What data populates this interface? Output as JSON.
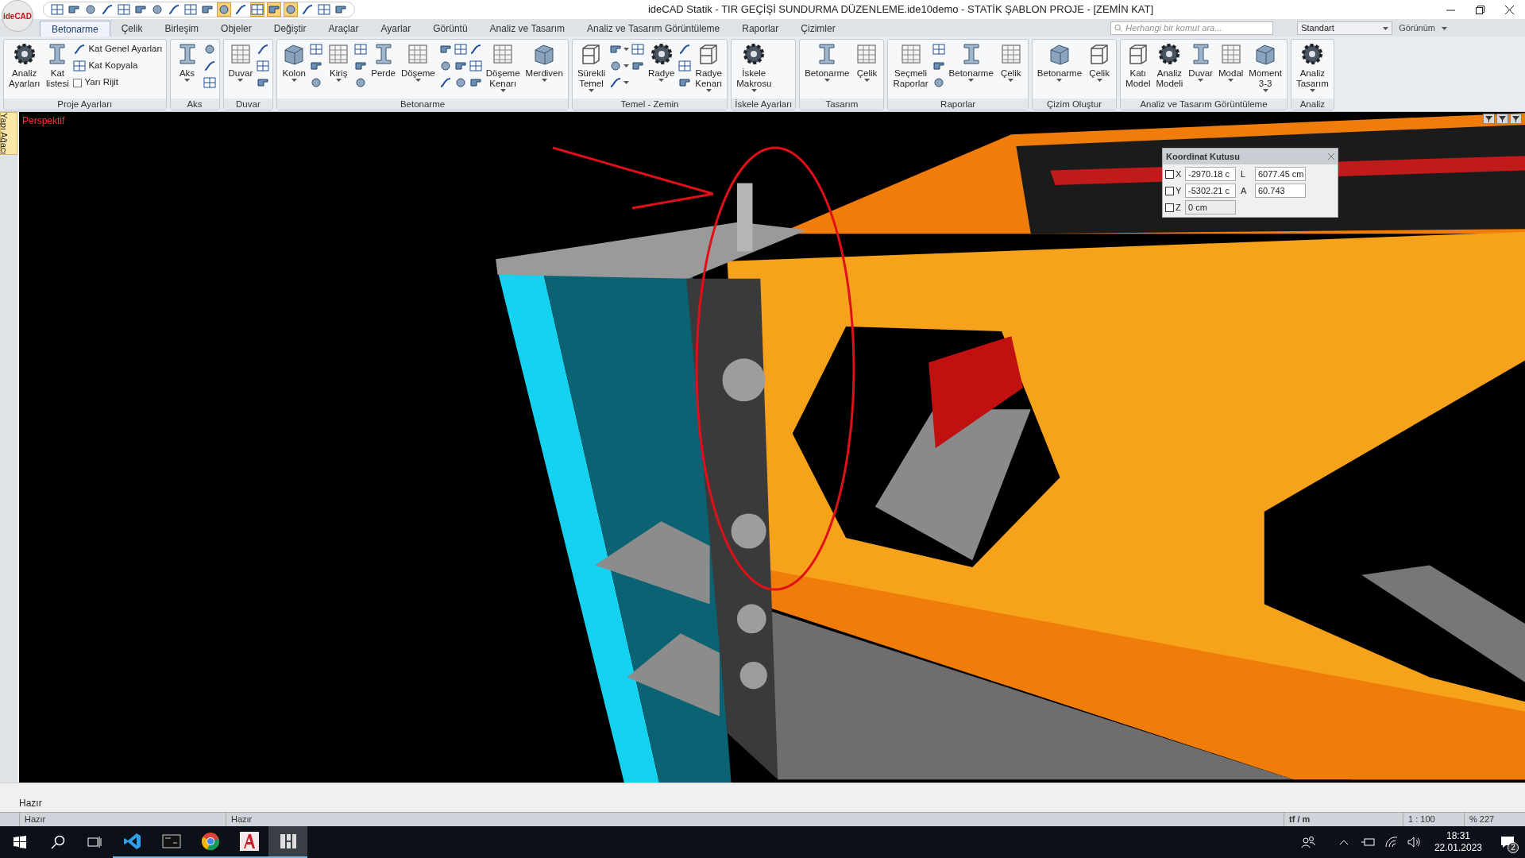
{
  "app": {
    "logo": "ideCAD",
    "title": "ideCAD Statik - TIR GEÇİŞİ SUNDURMA DÜZENLEME.ide10demo - STATİK ŞABLON PROJE - [ZEMİN KAT]"
  },
  "quick_access": [
    {
      "on": false
    },
    {
      "on": false
    },
    {
      "on": false
    },
    {
      "on": false
    },
    {
      "on": false
    },
    {
      "on": false
    },
    {
      "on": false
    },
    {
      "on": false
    },
    {
      "on": false
    },
    {
      "on": false
    },
    {
      "on": true
    },
    {
      "on": false
    },
    {
      "on": true
    },
    {
      "on": true
    },
    {
      "on": true
    },
    {
      "on": false
    },
    {
      "on": false
    },
    {
      "on": false
    }
  ],
  "tabs": [
    {
      "label": "Betonarme",
      "selected": true
    },
    {
      "label": "Çelik",
      "selected": false
    },
    {
      "label": "Birleşim",
      "selected": false
    },
    {
      "label": "Objeler",
      "selected": false
    },
    {
      "label": "Değiştir",
      "selected": false
    },
    {
      "label": "Araçlar",
      "selected": false
    },
    {
      "label": "Ayarlar",
      "selected": false
    },
    {
      "label": "Görüntü",
      "selected": false
    },
    {
      "label": "Analiz ve Tasarım",
      "selected": false
    },
    {
      "label": "Analiz ve Tasarım Görüntüleme",
      "selected": false
    },
    {
      "label": "Raporlar",
      "selected": false
    },
    {
      "label": "Çizimler",
      "selected": false
    }
  ],
  "search": {
    "placeholder": "Herhangi bir komut ara..."
  },
  "style_select": {
    "value": "Standart"
  },
  "view_menu": {
    "label": "Görünüm"
  },
  "ribbon": [
    {
      "label": "Proje Ayarları",
      "items": [
        {
          "kind": "large",
          "lines": [
            "Analiz",
            "Ayarları"
          ],
          "dropdown": false
        },
        {
          "kind": "large",
          "lines": [
            "Kat",
            "listesi"
          ],
          "dropdown": false
        },
        {
          "kind": "row",
          "label": "Kat Genel Ayarları"
        },
        {
          "kind": "row",
          "label": "Kat Kopyala"
        },
        {
          "kind": "check",
          "label": "Yarı Rijit",
          "checked": false
        }
      ]
    },
    {
      "label": "Aks",
      "items": [
        {
          "kind": "large",
          "lines": [
            "Aks"
          ],
          "dropdown": true
        },
        {
          "kind": "small",
          "dropdown": false
        },
        {
          "kind": "small",
          "dropdown": false
        },
        {
          "kind": "small",
          "dropdown": false
        }
      ]
    },
    {
      "label": "Duvar",
      "items": [
        {
          "kind": "large",
          "lines": [
            "Duvar"
          ],
          "dropdown": true
        },
        {
          "kind": "small",
          "dropdown": false
        },
        {
          "kind": "small",
          "dropdown": false
        },
        {
          "kind": "small",
          "dropdown": false
        }
      ]
    },
    {
      "label": "Betonarme",
      "items": [
        {
          "kind": "large",
          "lines": [
            "Kolon"
          ],
          "dropdown": true
        },
        {
          "kind": "small",
          "dropdown": false
        },
        {
          "kind": "small",
          "dropdown": false
        },
        {
          "kind": "small",
          "dropdown": false
        },
        {
          "kind": "large",
          "lines": [
            "Kiriş"
          ],
          "dropdown": true
        },
        {
          "kind": "small",
          "dropdown": false
        },
        {
          "kind": "small",
          "dropdown": false
        },
        {
          "kind": "small",
          "dropdown": false
        },
        {
          "kind": "large",
          "lines": [
            "Perde"
          ],
          "dropdown": false
        },
        {
          "kind": "large",
          "lines": [
            "Döşeme"
          ],
          "dropdown": true
        },
        {
          "kind": "small",
          "dropdown": false
        },
        {
          "kind": "small",
          "dropdown": false
        },
        {
          "kind": "small",
          "dropdown": false
        },
        {
          "kind": "small",
          "dropdown": false
        },
        {
          "kind": "small",
          "dropdown": false
        },
        {
          "kind": "small",
          "dropdown": false
        },
        {
          "kind": "small",
          "dropdown": false
        },
        {
          "kind": "small",
          "dropdown": false
        },
        {
          "kind": "small",
          "dropdown": false
        },
        {
          "kind": "large",
          "lines": [
            "Döşeme",
            "Kenarı"
          ],
          "dropdown": true
        },
        {
          "kind": "large",
          "lines": [
            "Merdiven"
          ],
          "dropdown": true
        }
      ]
    },
    {
      "label": "Temel - Zemin",
      "items": [
        {
          "kind": "large",
          "lines": [
            "Sürekli",
            "Temel"
          ],
          "dropdown": true
        },
        {
          "kind": "small",
          "dropdown": true
        },
        {
          "kind": "small",
          "dropdown": true
        },
        {
          "kind": "small",
          "dropdown": true
        },
        {
          "kind": "small",
          "dropdown": false
        },
        {
          "kind": "small",
          "dropdown": false
        },
        {
          "kind": "large",
          "lines": [
            "Radye"
          ],
          "dropdown": true
        },
        {
          "kind": "small",
          "dropdown": false
        },
        {
          "kind": "small",
          "dropdown": false
        },
        {
          "kind": "small",
          "dropdown": false
        },
        {
          "kind": "large",
          "lines": [
            "Radye",
            "Kenarı"
          ],
          "dropdown": true
        }
      ]
    },
    {
      "label": "İskele Ayarları",
      "items": [
        {
          "kind": "large",
          "lines": [
            "İskele",
            "Makrosu"
          ],
          "dropdown": true
        }
      ]
    },
    {
      "label": "Tasarım",
      "items": [
        {
          "kind": "large",
          "lines": [
            "Betonarme"
          ],
          "dropdown": true
        },
        {
          "kind": "large",
          "lines": [
            "Çelik"
          ],
          "dropdown": true
        }
      ]
    },
    {
      "label": "Raporlar",
      "items": [
        {
          "kind": "large",
          "lines": [
            "Seçmeli",
            "Raporlar"
          ],
          "dropdown": false
        },
        {
          "kind": "small",
          "dropdown": false
        },
        {
          "kind": "small",
          "dropdown": false
        },
        {
          "kind": "small",
          "dropdown": false
        },
        {
          "kind": "large",
          "lines": [
            "Betonarme"
          ],
          "dropdown": true
        },
        {
          "kind": "large",
          "lines": [
            "Çelik"
          ],
          "dropdown": true
        }
      ]
    },
    {
      "label": "Çizim Oluştur",
      "items": [
        {
          "kind": "large",
          "lines": [
            "Betonarme"
          ],
          "dropdown": true
        },
        {
          "kind": "large",
          "lines": [
            "Çelik"
          ],
          "dropdown": true
        }
      ]
    },
    {
      "label": "Analiz ve Tasarım Görüntüleme",
      "items": [
        {
          "kind": "large",
          "lines": [
            "Katı",
            "Model"
          ],
          "dropdown": false
        },
        {
          "kind": "large",
          "lines": [
            "Analiz",
            "Modeli"
          ],
          "dropdown": false
        },
        {
          "kind": "large",
          "lines": [
            "Duvar"
          ],
          "dropdown": true
        },
        {
          "kind": "large",
          "lines": [
            "Modal"
          ],
          "dropdown": true
        },
        {
          "kind": "large",
          "lines": [
            "Moment",
            "3-3"
          ],
          "dropdown": true
        }
      ]
    },
    {
      "label": "Analiz",
      "items": [
        {
          "kind": "large",
          "lines": [
            "Analiz",
            "Tasarım"
          ],
          "dropdown": true
        }
      ]
    }
  ],
  "side_tab": {
    "label": "Yapı Ağacı"
  },
  "viewport": {
    "label": "Perspektif"
  },
  "coordinate_box": {
    "title": "Koordinat Kutusu",
    "rows": [
      {
        "axis": "X",
        "checked": false,
        "value": "-2970.18 c",
        "extra_label": "L",
        "extra_value": "6077.45 cm"
      },
      {
        "axis": "Y",
        "checked": false,
        "value": "-5302.21 c",
        "extra_label": "A",
        "extra_value": "60.743"
      },
      {
        "axis": "Z",
        "checked": false,
        "value": "0 cm"
      }
    ]
  },
  "command_line": {
    "text": "Hazır"
  },
  "status_bar": [
    "Hazır",
    "Hazır",
    "tf / m",
    "1 : 100",
    "% 227"
  ],
  "taskbar": {
    "apps": [
      {
        "kind": "code",
        "running": true,
        "selected": false
      },
      {
        "kind": "terminal",
        "running": true,
        "selected": false
      },
      {
        "kind": "browser",
        "running": true,
        "selected": false
      },
      {
        "kind": "cad",
        "running": true,
        "selected": false
      },
      {
        "kind": "grid",
        "running": true,
        "selected": true
      }
    ],
    "time": "18:31",
    "date": "22.01.2023",
    "notifications": "2"
  }
}
